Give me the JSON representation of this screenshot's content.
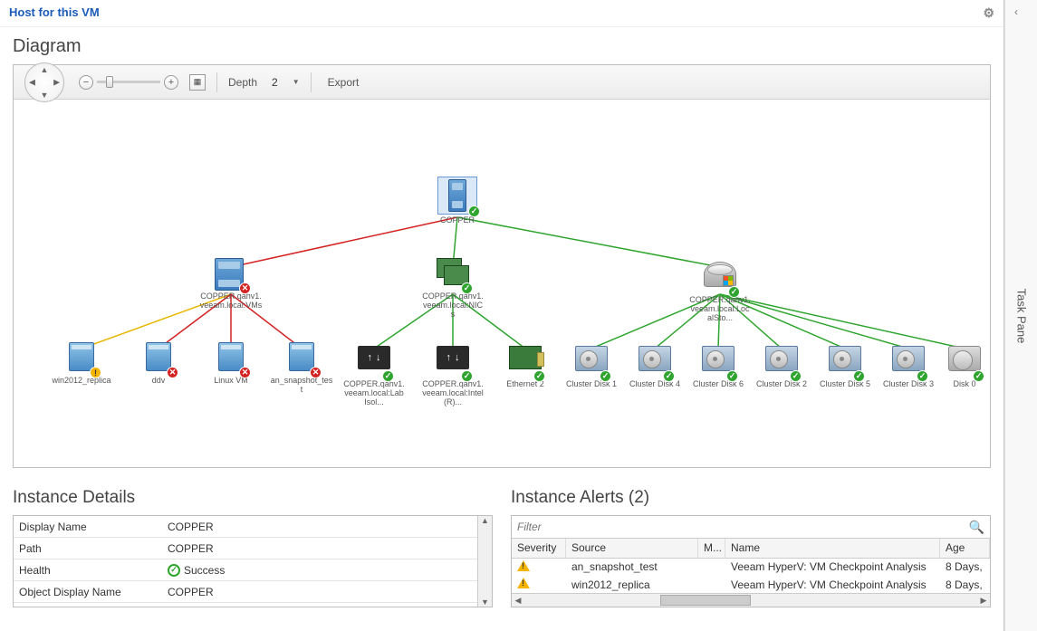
{
  "title": "Host for this VM",
  "section": "Diagram",
  "toolbar": {
    "depth_label": "Depth",
    "depth_value": "2",
    "export_label": "Export"
  },
  "nodes": {
    "root": {
      "label": "COPPER"
    },
    "vms": {
      "label": "COPPER.qahv1.veeam.local:VMs"
    },
    "nics": {
      "label": "COPPER.qahv1.veeam.local:NICs"
    },
    "storage": {
      "label": "COPPER.qahv1.veeam.local:LocalSto..."
    },
    "vm1": {
      "label": "win2012_replica"
    },
    "vm2": {
      "label": "ddv"
    },
    "vm3": {
      "label": "Linux VM"
    },
    "vm4": {
      "label": "an_snapshot_test"
    },
    "sw1": {
      "label": "COPPER.qahv1.veeam.local:Lab Isol..."
    },
    "sw2": {
      "label": "COPPER.qahv1.veeam.local:Intel(R)..."
    },
    "eth": {
      "label": "Ethernet 2"
    },
    "d1": {
      "label": "Cluster Disk 1"
    },
    "d4": {
      "label": "Cluster Disk 4"
    },
    "d6": {
      "label": "Cluster Disk 6"
    },
    "d2": {
      "label": "Cluster Disk 2"
    },
    "d5": {
      "label": "Cluster Disk 5"
    },
    "d3": {
      "label": "Cluster Disk 3"
    },
    "d0": {
      "label": "Disk 0"
    }
  },
  "details": {
    "title": "Instance Details",
    "rows": [
      {
        "k": "Display Name",
        "v": "COPPER"
      },
      {
        "k": "Path",
        "v": "COPPER"
      },
      {
        "k": "Health",
        "v": "Success",
        "icon": "success"
      },
      {
        "k": "Object Display Name",
        "v": "COPPER"
      }
    ]
  },
  "alerts": {
    "title": "Instance Alerts (2)",
    "filter_placeholder": "Filter",
    "columns": {
      "sev": "Severity",
      "src": "Source",
      "m": "M...",
      "name": "Name",
      "age": "Age"
    },
    "rows": [
      {
        "src": "an_snapshot_test",
        "name": "Veeam HyperV: VM Checkpoint Analysis",
        "age": "8 Days,"
      },
      {
        "src": "win2012_replica",
        "name": "Veeam HyperV: VM Checkpoint Analysis",
        "age": "8 Days,"
      }
    ]
  },
  "task_pane_label": "Task Pane"
}
